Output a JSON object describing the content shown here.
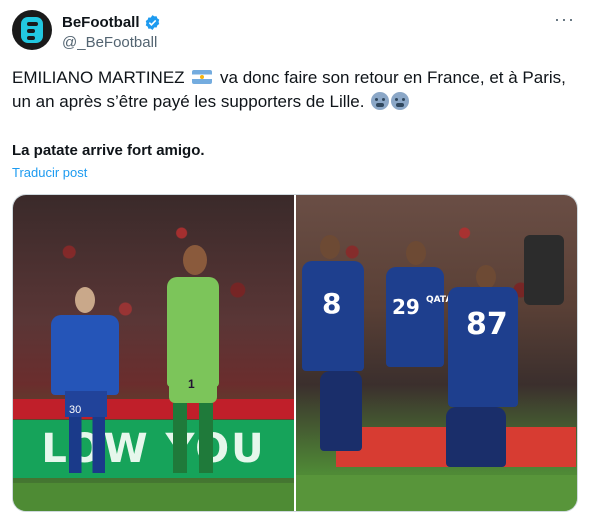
{
  "account": {
    "display_name": "BeFootball",
    "handle": "@_BeFootball",
    "verified_icon": "verified-badge-icon",
    "more_label": "···"
  },
  "tweet": {
    "text_part1": "EMILIANO MARTINEZ",
    "text_part2": "va donc faire son retour en France, et à Paris, un an après s’être payé les supporters de Lille.",
    "flag_icon": "argentina-flag-emoji",
    "reaction_icon": "cold-face-emoji",
    "bold_line": "La patate arrive fort amigo.",
    "translate_label": "Traducir post"
  },
  "media": {
    "left_photo": {
      "board_text": "LOW YOU",
      "goalkeeper_number": "1",
      "lille_player_number": "30"
    },
    "right_photo": {
      "player_numbers": [
        "8",
        "87",
        "29"
      ],
      "sponsor_text": "QATAR"
    }
  },
  "colors": {
    "link": "#1d9bf0",
    "secondary_text": "#536471",
    "verified": "#1d9bf0"
  }
}
